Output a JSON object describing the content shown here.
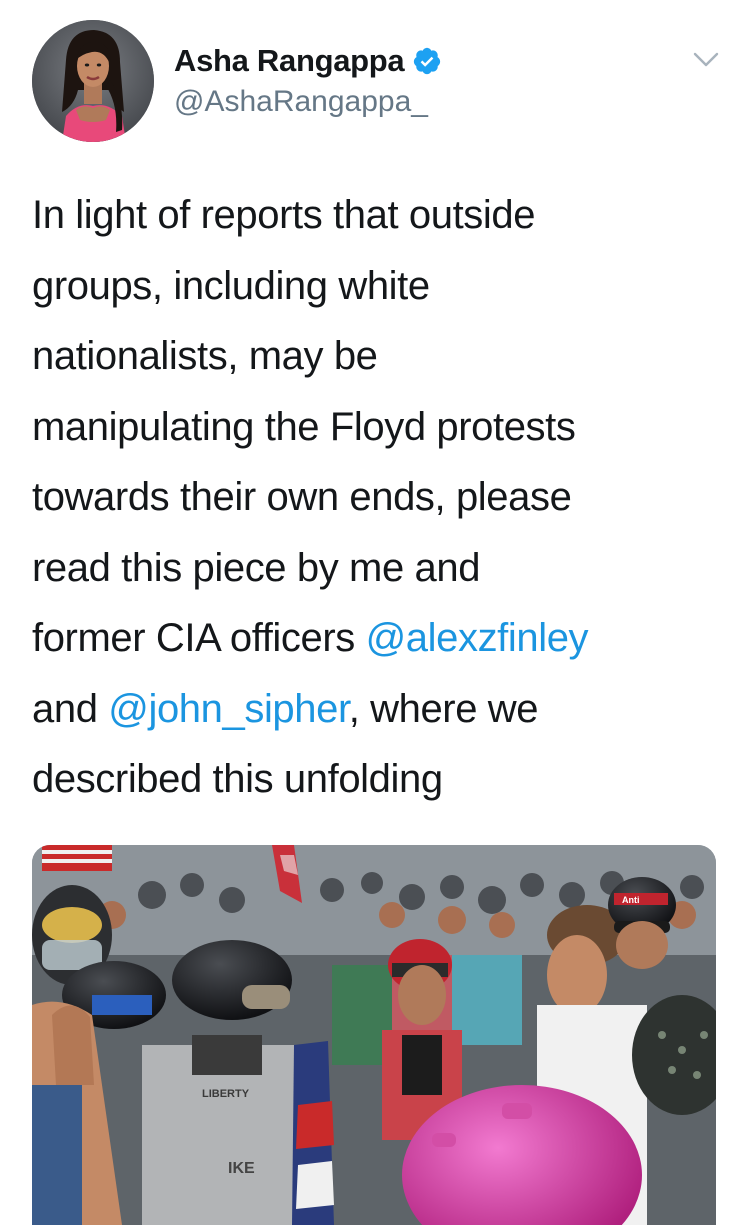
{
  "tweet": {
    "author": {
      "display_name": "Asha Rangappa",
      "handle": "@AshaRangappa_",
      "verified": true,
      "avatar_icon": "person-avatar-icon"
    },
    "text": {
      "segments": [
        {
          "type": "text",
          "value": "In light of reports that outside\ngroups, including white\nnationalists, may be\nmanipulating the Floyd protests\ntowards their own ends, please\nread this piece by me and\nformer CIA officers "
        },
        {
          "type": "mention",
          "value": "@alexzfinley"
        },
        {
          "type": "text",
          "value": "\nand "
        },
        {
          "type": "mention",
          "value": "@john_sipher"
        },
        {
          "type": "text",
          "value": ", where we\ndescribed this unfolding"
        }
      ]
    },
    "media": {
      "icon": "protest-crowd-photo",
      "text_fragments": [
        "Anti",
        "LIBERTY",
        "IKE"
      ]
    },
    "colors": {
      "link": "#1b95e0",
      "verified": "#1da1f2",
      "secondary_text": "#657786",
      "primary_text": "#14171a"
    }
  }
}
